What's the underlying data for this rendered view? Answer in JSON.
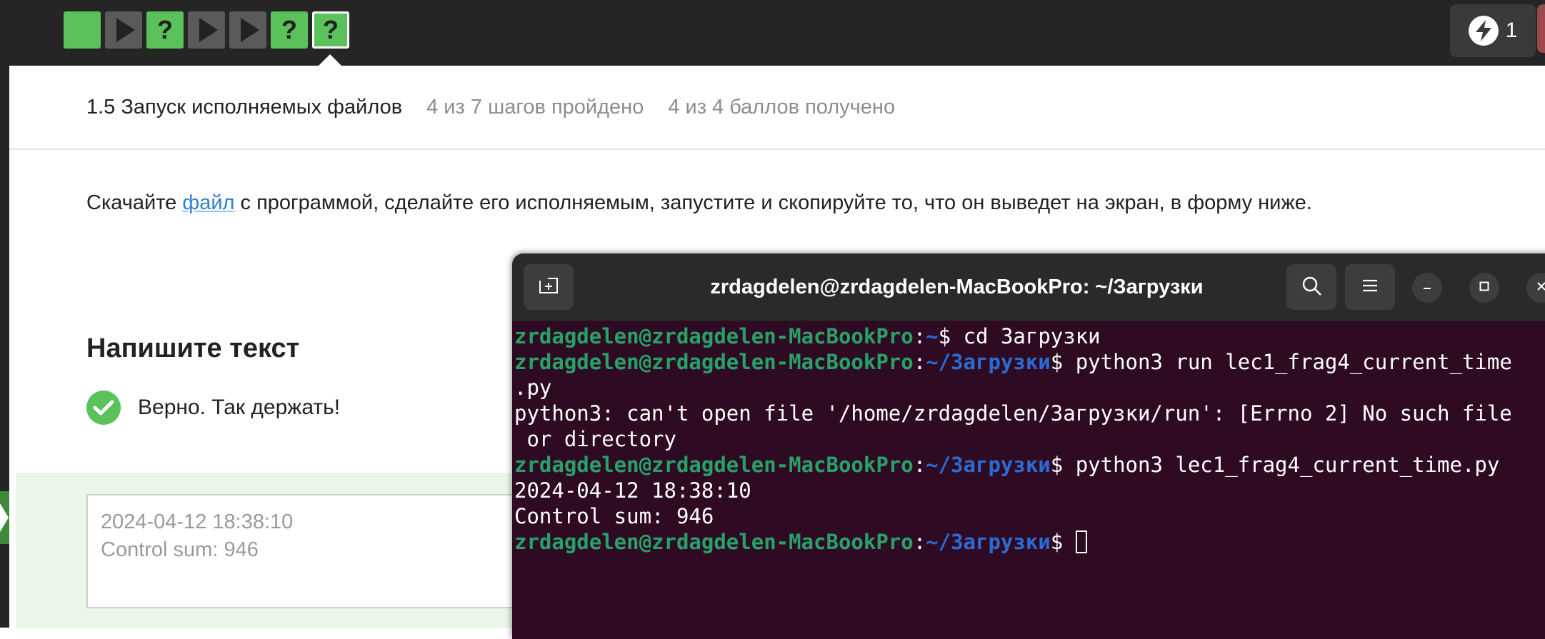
{
  "steps": [
    {
      "kind": "blank",
      "state": "passed"
    },
    {
      "kind": "play",
      "state": "unvisited"
    },
    {
      "kind": "question",
      "label": "?",
      "state": "passed"
    },
    {
      "kind": "play",
      "state": "unvisited"
    },
    {
      "kind": "play",
      "state": "unvisited"
    },
    {
      "kind": "question",
      "label": "?",
      "state": "passed"
    },
    {
      "kind": "question",
      "label": "?",
      "state": "active"
    }
  ],
  "energy": {
    "count": "1",
    "icon": "lightning-bolt-icon"
  },
  "lesson": {
    "title": "1.5 Запуск исполняемых файлов",
    "progress": "4 из 7 шагов пройдено",
    "score": "4 из 4 баллов  получено"
  },
  "task": {
    "before": "Скачайте ",
    "link": "файл",
    "after": " с программой, сделайте его исполняемым, запустите и скопируйте то, что он выведет на экран, в форму ниже."
  },
  "answer": {
    "heading": "Напишите текст",
    "verdict": "Верно. Так держать!",
    "lines": [
      "2024-04-12 18:38:10",
      "Control sum: 946"
    ]
  },
  "terminal": {
    "title": "zrdagdelen@zrdagdelen-MacBookPro: ~/Загрузки",
    "buttons": {
      "new_tab": "new-tab-icon",
      "search": "search-icon",
      "menu": "hamburger-menu-icon",
      "minimize": "minimize-icon",
      "maximize": "maximize-icon",
      "close": "close-icon"
    },
    "user": "zrdagdelen@zrdagdelen-MacBookPro",
    "lines": [
      {
        "type": "prompt",
        "path": "~",
        "cmd": " cd Загрузки"
      },
      {
        "type": "prompt",
        "path": "~/Загрузки",
        "cmd": " python3 run lec1_frag4_current_time"
      },
      {
        "type": "output",
        "text": ".py"
      },
      {
        "type": "output",
        "text": "python3: can't open file '/home/zrdagdelen/Загрузки/run': [Errno 2] No such file"
      },
      {
        "type": "output",
        "text": " or directory"
      },
      {
        "type": "prompt",
        "path": "~/Загрузки",
        "cmd": " python3 lec1_frag4_current_time.py"
      },
      {
        "type": "output",
        "text": "2024-04-12 18:38:10"
      },
      {
        "type": "output",
        "text": "Control sum: 946"
      },
      {
        "type": "prompt",
        "path": "~/Загрузки",
        "cmd": " ",
        "cursor": true
      }
    ]
  }
}
